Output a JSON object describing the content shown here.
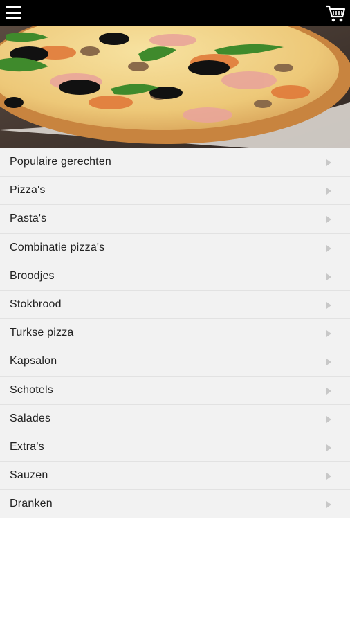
{
  "colors": {
    "topbar": "#000000",
    "list_bg": "#f2f2f2",
    "divider": "#e2e2e2",
    "text": "#222222",
    "arrow": "#c8c8c8"
  },
  "topbar": {
    "menu_icon": "hamburger-menu-icon",
    "cart_icon": "shopping-cart-icon"
  },
  "hero": {
    "image": "pizza-photo"
  },
  "categories": [
    {
      "label": "Populaire gerechten"
    },
    {
      "label": "Pizza's"
    },
    {
      "label": "Pasta's"
    },
    {
      "label": "Combinatie pizza's"
    },
    {
      "label": "Broodjes"
    },
    {
      "label": "Stokbrood"
    },
    {
      "label": "Turkse pizza"
    },
    {
      "label": "Kapsalon"
    },
    {
      "label": "Schotels"
    },
    {
      "label": "Salades"
    },
    {
      "label": "Extra's"
    },
    {
      "label": "Sauzen"
    },
    {
      "label": "Dranken"
    }
  ]
}
